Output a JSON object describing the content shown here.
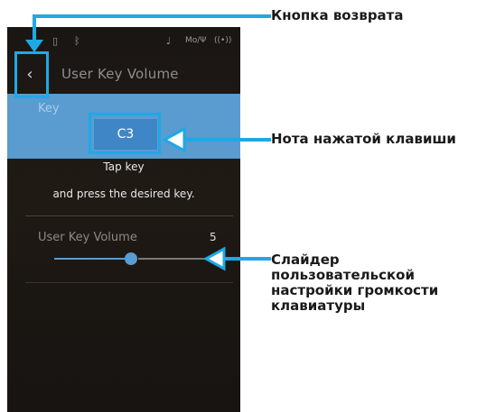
{
  "screen": {
    "title": "User Key Volume",
    "back_icon": "chevron-left-icon",
    "status_icons": [
      "usb-icon",
      "bluetooth-icon",
      "mic-icon",
      "midi-icon",
      "wireless-icon"
    ],
    "key_section_label": "Key",
    "key_value": "C3",
    "instruction_line1": "Tap key",
    "instruction_line2": "and press the desired key.",
    "volume_label": "User Key Volume",
    "volume_value": "5",
    "volume_fraction": 0.5,
    "accent_color": "#5a9bd0",
    "highlight_color": "#1ea9e6"
  },
  "annotations": {
    "back_button": "Кнопка возврата",
    "note_key": "Нота нажатой клавиши",
    "slider_line1": "Слайдер",
    "slider_line2": "пользовательской",
    "slider_line3": "настройки громкости",
    "slider_line4": "клавиатуры"
  }
}
